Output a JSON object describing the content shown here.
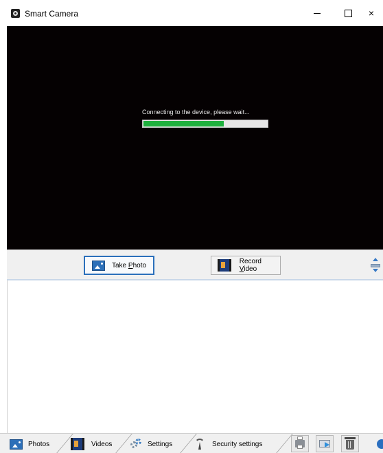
{
  "window": {
    "title": "Smart Camera",
    "controls": {
      "minimize": "–",
      "maximize": "☐",
      "close": "×"
    }
  },
  "video": {
    "status_text": "Connecting to the device, please wait...",
    "progress": 0.65,
    "background_color": "#050102",
    "progress_color": "#1eb03d"
  },
  "toolbar": {
    "take_photo": {
      "pre": "Take ",
      "mnemonic": "P",
      "post": "hoto",
      "icon": "photo-icon"
    },
    "record_video": {
      "pre": "Record ",
      "mnemonic": "V",
      "post": "ideo",
      "icon": "film-icon"
    },
    "splitter_icon": "splitter-icon"
  },
  "tabs": [
    {
      "label": "Photos",
      "icon": "photo-icon"
    },
    {
      "label": "Videos",
      "icon": "film-icon"
    },
    {
      "label": "Settings",
      "icon": "gear-icon"
    },
    {
      "label": "Security settings",
      "icon": "antenna-icon"
    }
  ],
  "bottom_tools": {
    "print_icon": "printer-icon",
    "email_icon": "email-icon",
    "delete_icon": "trash-icon",
    "help_icon": "help-icon"
  },
  "colors": {
    "accent": "#2a6fbb",
    "toolbar_bg": "#f0f0f0"
  }
}
